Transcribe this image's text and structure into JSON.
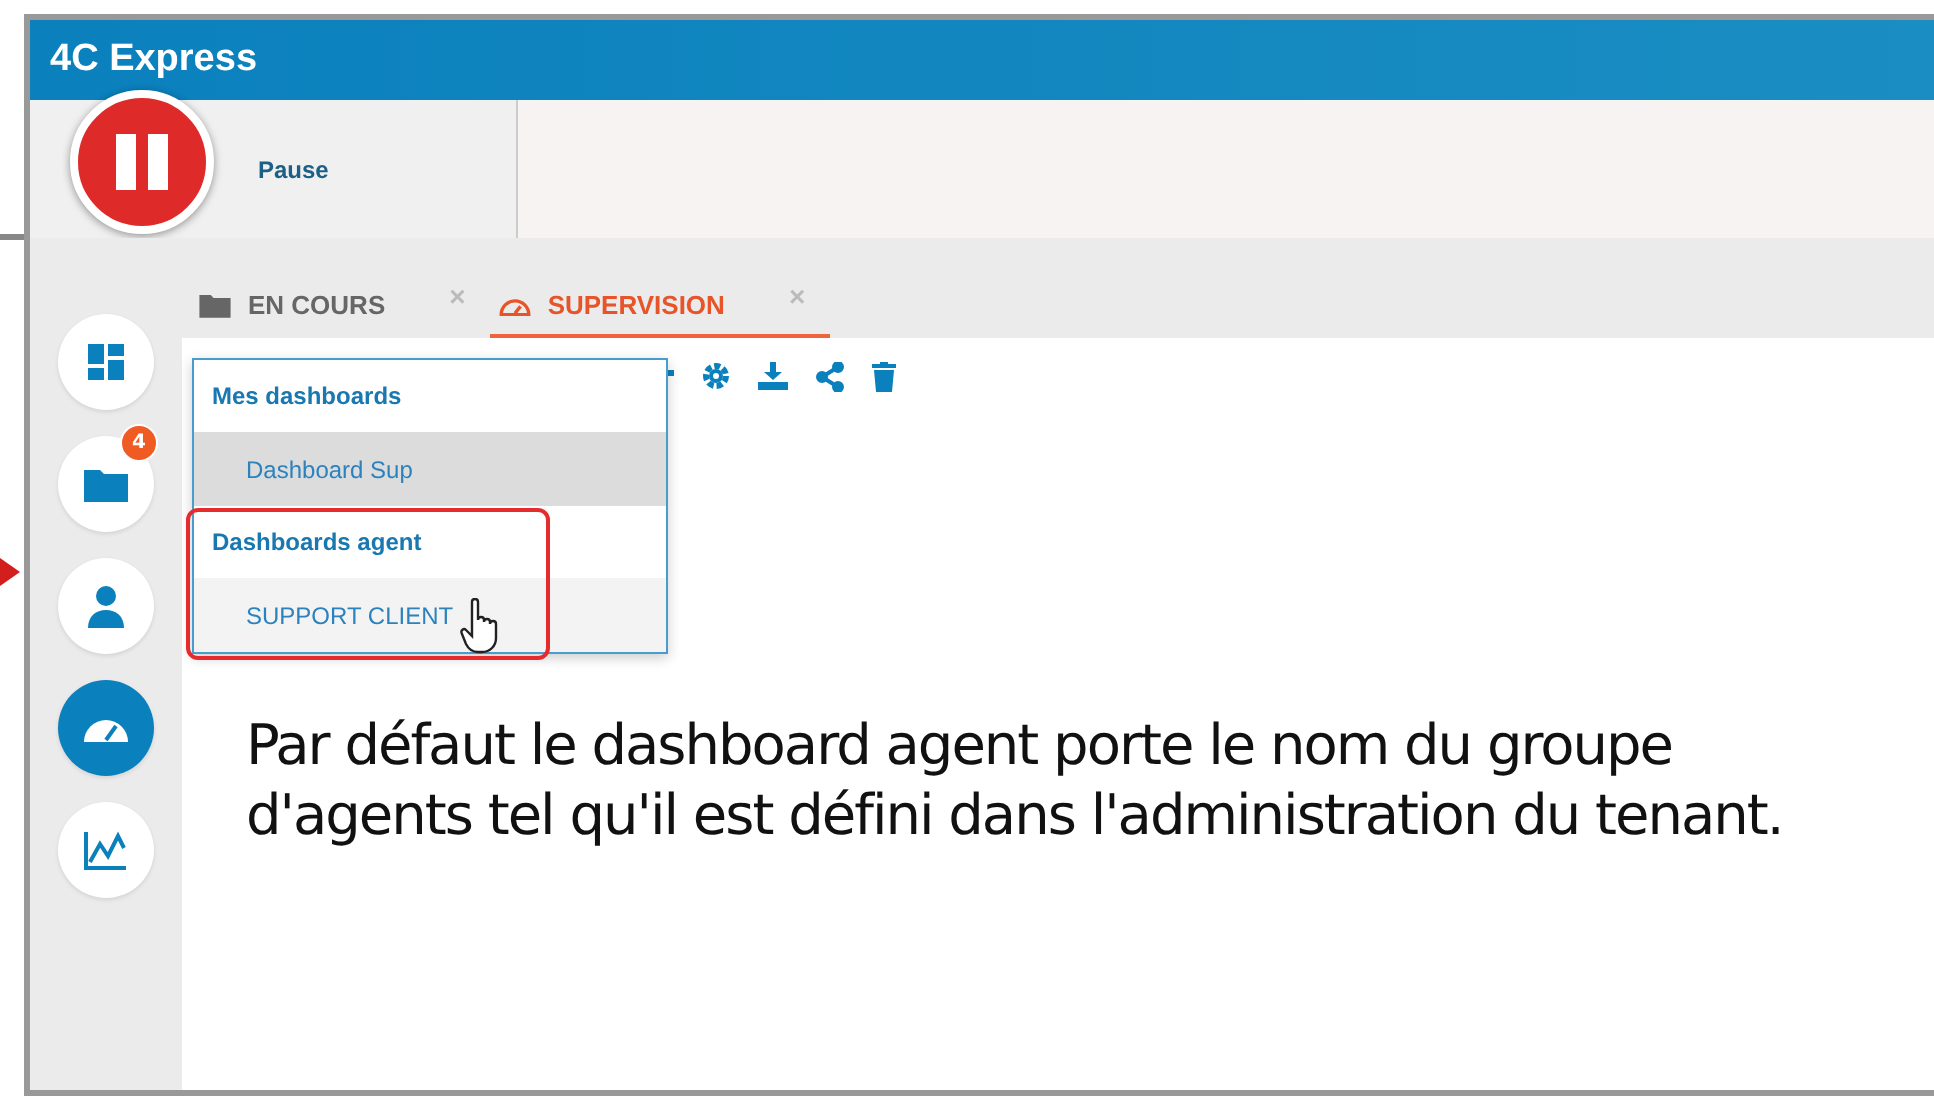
{
  "window": {
    "title": "4C Express"
  },
  "header": {
    "pause_label": "Pause"
  },
  "sidebar": {
    "items": [
      {
        "kind": "dashboard",
        "selected": false
      },
      {
        "kind": "folder",
        "selected": false,
        "badge": "4"
      },
      {
        "kind": "agent",
        "selected": false
      },
      {
        "kind": "gauge",
        "selected": true
      },
      {
        "kind": "chart",
        "selected": false
      }
    ]
  },
  "tabs": [
    {
      "label": "EN COURS",
      "kind": "folder",
      "selected": false,
      "close": "×"
    },
    {
      "label": "SUPERVISION",
      "kind": "gauge",
      "selected": true,
      "close": "×"
    }
  ],
  "dropdown": {
    "sections": [
      {
        "title": "Mes dashboards",
        "highlighted": false,
        "items": [
          {
            "label": "Dashboard Sup",
            "selected": true
          }
        ]
      },
      {
        "title": "Dashboards agent",
        "highlighted": true,
        "items": [
          {
            "label": "SUPPORT CLIENT",
            "selected": false
          }
        ]
      }
    ]
  },
  "annotation": "Par défaut le dashboard agent porte le nom du groupe d'agents tel qu'il est défini dans l'administration du tenant."
}
